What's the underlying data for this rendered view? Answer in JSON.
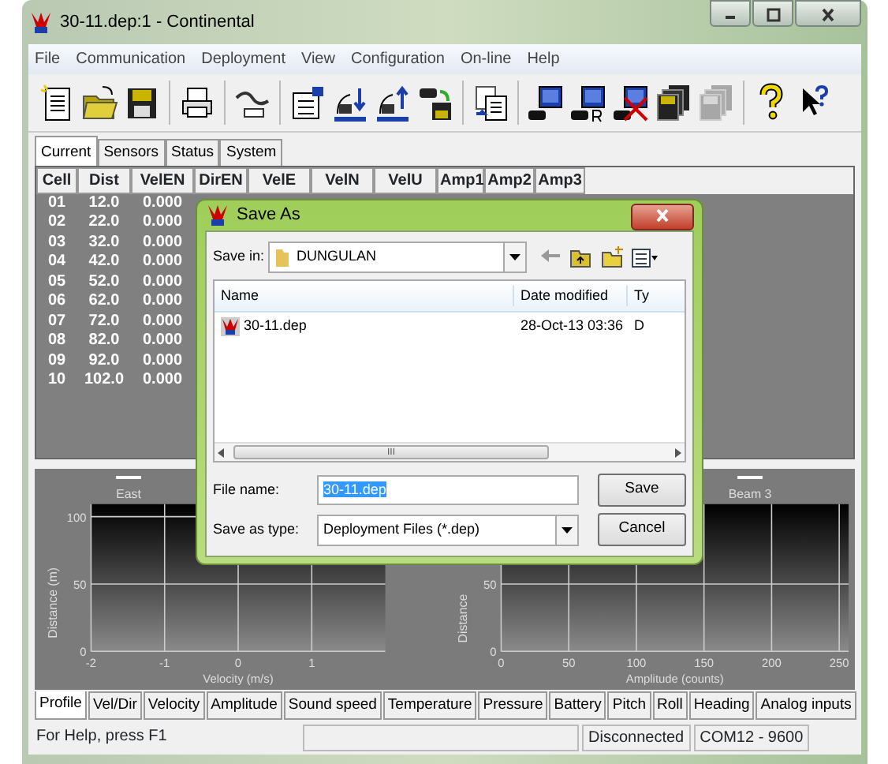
{
  "window": {
    "title": "30-11.dep:1 - Continental"
  },
  "menu": [
    "File",
    "Communication",
    "Deployment",
    "View",
    "Configuration",
    "On-line",
    "Help"
  ],
  "toolbar": [
    {
      "kind": "new",
      "disabled": false
    },
    {
      "kind": "open",
      "disabled": false
    },
    {
      "kind": "save",
      "disabled": false
    },
    {
      "kind": "sep"
    },
    {
      "kind": "print",
      "disabled": false
    },
    {
      "kind": "sep"
    },
    {
      "kind": "cable",
      "disabled": false
    },
    {
      "kind": "sep"
    },
    {
      "kind": "form",
      "disabled": false
    },
    {
      "kind": "down",
      "disabled": false
    },
    {
      "kind": "up",
      "disabled": false
    },
    {
      "kind": "transfer",
      "disabled": false
    },
    {
      "kind": "sep"
    },
    {
      "kind": "doc",
      "disabled": false
    },
    {
      "kind": "sep"
    },
    {
      "kind": "pc",
      "disabled": false
    },
    {
      "kind": "pcr",
      "disabled": false
    },
    {
      "kind": "pcx",
      "disabled": false
    },
    {
      "kind": "floppy",
      "disabled": false
    },
    {
      "kind": "floppy",
      "disabled": true
    },
    {
      "kind": "sep"
    },
    {
      "kind": "help",
      "disabled": false
    },
    {
      "kind": "pointer",
      "disabled": false
    }
  ],
  "tabs": [
    {
      "label": "Current",
      "selected": true
    },
    {
      "label": "Sensors",
      "selected": false
    },
    {
      "label": "Status",
      "selected": false
    },
    {
      "label": "System",
      "selected": false
    }
  ],
  "table": {
    "columns": [
      "Cell",
      "Dist",
      "VelEN",
      "DirEN",
      "VelE",
      "VelN",
      "VelU",
      "Amp1",
      "Amp2",
      "Amp3"
    ],
    "rows": [
      [
        "01",
        "12.0",
        "0.000"
      ],
      [
        "02",
        "22.0",
        "0.000"
      ],
      [
        "03",
        "32.0",
        "0.000"
      ],
      [
        "04",
        "42.0",
        "0.000"
      ],
      [
        "05",
        "52.0",
        "0.000"
      ],
      [
        "06",
        "62.0",
        "0.000"
      ],
      [
        "07",
        "72.0",
        "0.000"
      ],
      [
        "08",
        "82.0",
        "0.000"
      ],
      [
        "09",
        "92.0",
        "0.000"
      ],
      [
        "10",
        "102.0",
        "0.000"
      ]
    ]
  },
  "charts": [
    {
      "legend": "East",
      "ylabel": "Distance (m)",
      "yticks": [
        "100",
        "50",
        "0"
      ],
      "xticks": [
        "-2",
        "-1",
        "0",
        "1"
      ],
      "xlabel": "Velocity (m/s)"
    },
    {
      "legend": "Beam 3",
      "ylabel": "Distance",
      "yticks": [
        "50",
        "0"
      ],
      "xticks": [
        "0",
        "50",
        "100",
        "150",
        "200",
        "250"
      ],
      "xlabel": "Amplitude (counts)"
    }
  ],
  "bottom_tabs": [
    {
      "label": "Profile",
      "selected": true
    },
    {
      "label": "Vel/Dir",
      "selected": false
    },
    {
      "label": "Velocity",
      "selected": false
    },
    {
      "label": "Amplitude",
      "selected": false
    },
    {
      "label": "Sound speed",
      "selected": false
    },
    {
      "label": "Temperature",
      "selected": false
    },
    {
      "label": "Pressure",
      "selected": false
    },
    {
      "label": "Battery",
      "selected": false
    },
    {
      "label": "Pitch",
      "selected": false
    },
    {
      "label": "Roll",
      "selected": false
    },
    {
      "label": "Heading",
      "selected": false
    },
    {
      "label": "Analog inputs",
      "selected": false
    }
  ],
  "status_bar": [
    "For Help, press F1",
    "Disconnected",
    "COM12 - 9600"
  ],
  "dialog": {
    "title": "Save As",
    "save_in_label": "Save in:",
    "save_in": "DUNGULAN",
    "columns": [
      "Name",
      "Date modified",
      "Ty"
    ],
    "files": [
      {
        "name": "30-11.dep",
        "date": "28-Oct-13 03:36",
        "type": "D"
      }
    ],
    "file_name_label": "File name:",
    "file_name": "30-11.dep",
    "file_type_label": "Save as type:",
    "file_type": "Deployment Files (*.dep)",
    "buttons": [
      "Save",
      "Cancel"
    ],
    "scroll_grip": "III"
  }
}
